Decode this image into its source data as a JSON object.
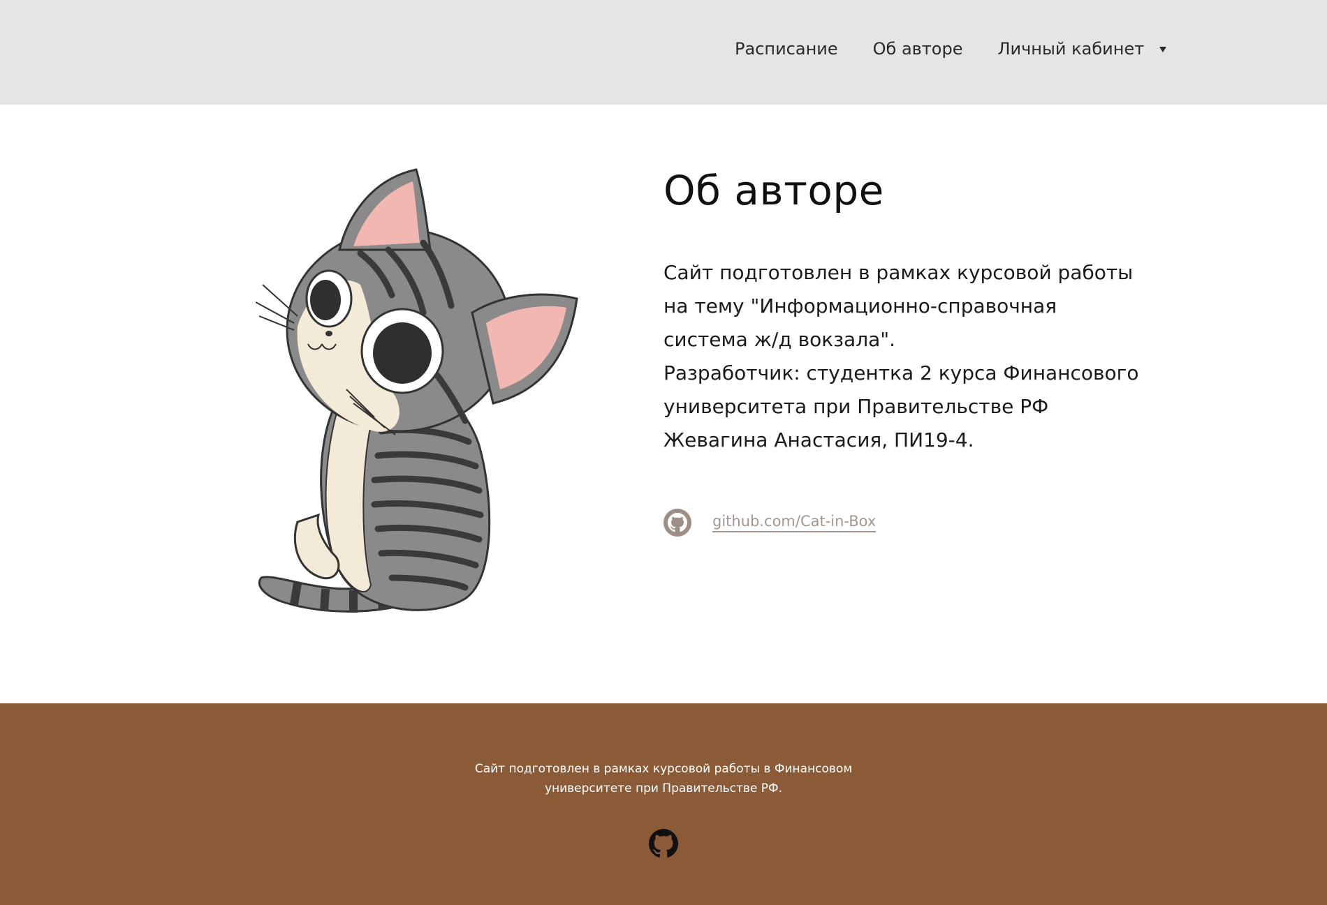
{
  "header": {
    "nav": [
      {
        "label": "Расписание"
      },
      {
        "label": "Об авторе"
      },
      {
        "label": "Личный кабинет"
      }
    ]
  },
  "main": {
    "title": "Об авторе",
    "description_lines": [
      "Сайт подготовлен в рамках курсовой работы",
      "на тему \"Информационно-справочная",
      "система ж/д вокзала\".",
      "Разработчик: студентка 2 курса Финансового",
      "университета при Правительстве РФ",
      "Жевагина Анастасия, ПИ19-4."
    ],
    "github_link": "github.com/Cat-in-Box"
  },
  "footer": {
    "lines": [
      "Сайт подготовлен в рамках курсовой работы в Финансовом",
      "университете при Правительстве РФ."
    ]
  },
  "colors": {
    "header_bg": "#e5e5e5",
    "footer_bg": "#8b5b37",
    "link": "#a39890"
  },
  "icons": {
    "nav_dropdown": "caret-down-icon",
    "main_link": "github-icon",
    "footer": "github-icon"
  }
}
